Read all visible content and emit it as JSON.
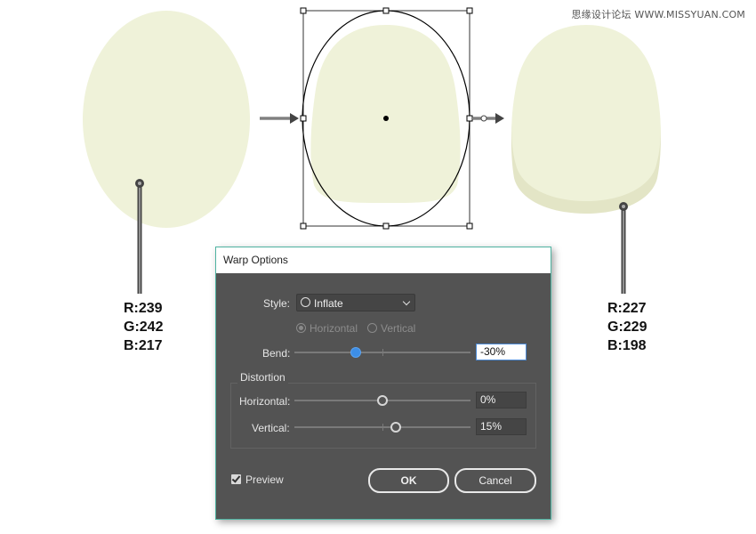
{
  "watermark": "思缘设计论坛 WWW.MISSYUAN.COM",
  "left_color": {
    "r": "R:239",
    "g": "G:242",
    "b": "B:217",
    "hex": "#eff2d9"
  },
  "right_color": {
    "r": "R:227",
    "g": "G:229",
    "b": "B:198",
    "hex": "#e3e5c6"
  },
  "dialog": {
    "title": "Warp Options",
    "style_label": "Style:",
    "style_value": "Inflate",
    "horizontal_label": "Horizontal",
    "vertical_label": "Vertical",
    "orientation_selected": "Horizontal",
    "bend_label": "Bend:",
    "bend_value": "-30%",
    "bend_percent": -30,
    "distortion_label": "Distortion",
    "dist_horizontal_label": "Horizontal:",
    "dist_horizontal_value": "0%",
    "dist_horizontal_percent": 0,
    "dist_vertical_label": "Vertical:",
    "dist_vertical_value": "15%",
    "dist_vertical_percent": 15,
    "preview_label": "Preview",
    "preview_checked": true,
    "ok_label": "OK",
    "cancel_label": "Cancel"
  },
  "icons": {
    "arrow_left": "arrow-right-icon",
    "arrow_right": "arrow-right-icon",
    "eyedropper": "eyedropper-icon",
    "chevron": "chevron-down-icon",
    "checkbox": "checkbox-checked-icon"
  }
}
